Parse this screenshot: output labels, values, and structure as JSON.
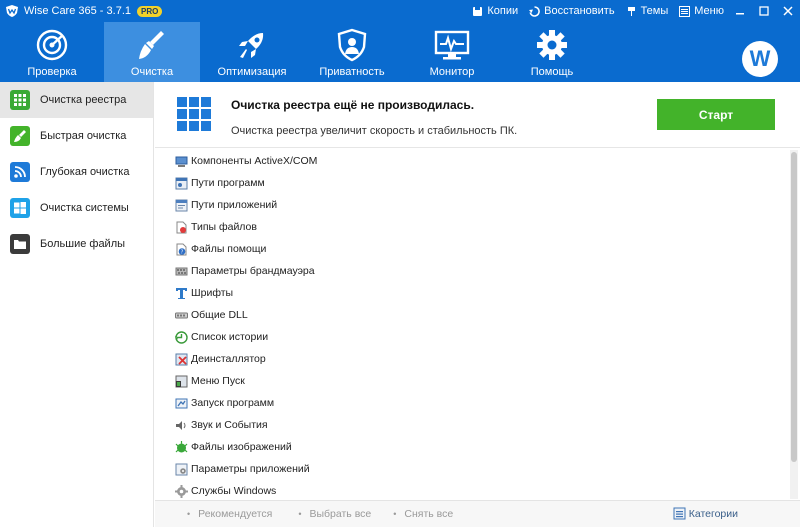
{
  "titlebar": {
    "title": "Wise Care 365 - 3.7.1",
    "badge": "PRO",
    "actions": [
      {
        "label": "Копии",
        "icon": "backup-icon"
      },
      {
        "label": "Восстановить",
        "icon": "restore-icon"
      },
      {
        "label": "Темы",
        "icon": "themes-icon"
      },
      {
        "label": "Меню",
        "icon": "menu-icon"
      }
    ]
  },
  "nav": {
    "tabs": [
      {
        "label": "Проверка",
        "icon": "radar-icon",
        "active": false
      },
      {
        "label": "Очистка",
        "icon": "broom-icon",
        "active": true
      },
      {
        "label": "Оптимизация",
        "icon": "rocket-icon",
        "active": false
      },
      {
        "label": "Приватность",
        "icon": "shield-icon",
        "active": false
      },
      {
        "label": "Монитор",
        "icon": "monitor-icon",
        "active": false
      },
      {
        "label": "Помощь",
        "icon": "gear-icon",
        "active": false
      }
    ],
    "avatar_letter": "W"
  },
  "sidebar": {
    "items": [
      {
        "label": "Очистка реестра",
        "icon": "registry-icon",
        "color": "#3aaa35",
        "active": true
      },
      {
        "label": "Быстрая очистка",
        "icon": "broom-icon",
        "color": "#43b32a",
        "active": false
      },
      {
        "label": "Глубокая очистка",
        "icon": "deep-clean-icon",
        "color": "#1e7ad8",
        "active": false
      },
      {
        "label": "Очистка системы",
        "icon": "windows-icon",
        "color": "#1fa2e8",
        "active": false
      },
      {
        "label": "Большие файлы",
        "icon": "folder-icon",
        "color": "#3b3b3b",
        "active": false
      }
    ]
  },
  "header": {
    "title": "Очистка реестра ещё не производилась.",
    "subtitle": "Очистка реестра увеличит скорость и стабильность ПК.",
    "start_label": "Старт"
  },
  "list": {
    "items": [
      {
        "label": "Компоненты ActiveX/COM",
        "icon": "activex-icon"
      },
      {
        "label": "Пути программ",
        "icon": "program-paths-icon"
      },
      {
        "label": "Пути приложений",
        "icon": "app-paths-icon"
      },
      {
        "label": "Типы файлов",
        "icon": "file-types-icon"
      },
      {
        "label": "Файлы помощи",
        "icon": "help-files-icon"
      },
      {
        "label": "Параметры брандмауэра",
        "icon": "firewall-icon"
      },
      {
        "label": "Шрифты",
        "icon": "fonts-icon"
      },
      {
        "label": "Общие DLL",
        "icon": "dll-icon"
      },
      {
        "label": "Список истории",
        "icon": "history-icon"
      },
      {
        "label": "Деинсталлятор",
        "icon": "uninstaller-icon"
      },
      {
        "label": "Меню Пуск",
        "icon": "start-menu-icon"
      },
      {
        "label": "Запуск программ",
        "icon": "startup-icon"
      },
      {
        "label": "Звук и События",
        "icon": "sound-icon"
      },
      {
        "label": "Файлы изображений",
        "icon": "image-files-icon"
      },
      {
        "label": "Параметры приложений",
        "icon": "app-settings-icon"
      },
      {
        "label": "Службы Windows",
        "icon": "services-icon"
      }
    ]
  },
  "footer": {
    "recommended": "Рекомендуется",
    "select_all": "Выбрать все",
    "deselect_all": "Снять все",
    "categories": "Категории"
  },
  "colors": {
    "primary": "#0a6bcf",
    "active_tab": "#3d8fe0",
    "start_button": "#43b32a"
  }
}
